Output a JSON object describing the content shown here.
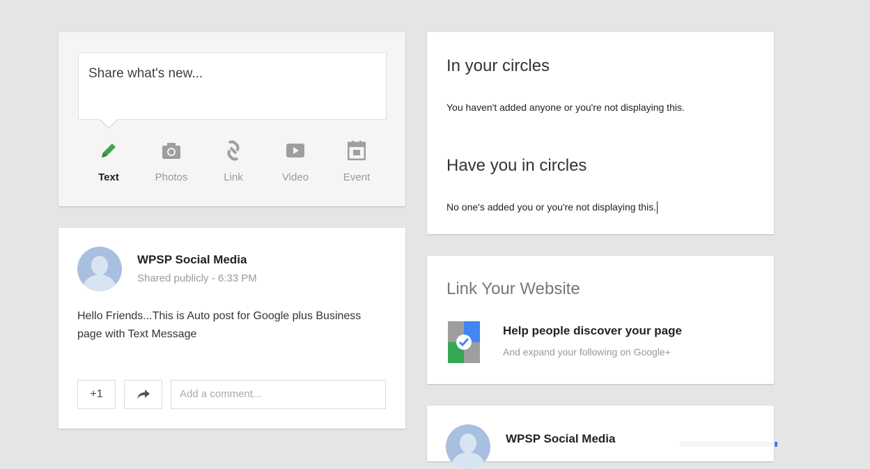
{
  "share": {
    "placeholder": "Share what's new...",
    "options": [
      {
        "label": "Text",
        "icon": "pencil-icon",
        "active": true
      },
      {
        "label": "Photos",
        "icon": "camera-icon",
        "active": false
      },
      {
        "label": "Link",
        "icon": "link-icon",
        "active": false
      },
      {
        "label": "Video",
        "icon": "video-icon",
        "active": false
      },
      {
        "label": "Event",
        "icon": "calendar-icon",
        "active": false
      }
    ]
  },
  "post": {
    "author": "WPSP Social Media",
    "meta": "Shared publicly  -  6:33 PM",
    "text": "Hello Friends...This is Auto post for Google plus Business page with Text Message",
    "plus_one": "+1",
    "share_icon": "share-arrow-icon",
    "comment_placeholder": "Add a comment..."
  },
  "circles": {
    "in_title": "In your circles",
    "in_text": "You haven't added anyone or you're not displaying this.",
    "have_title": "Have you in circles",
    "have_text": "No one's added you or you're not displaying this."
  },
  "link_site": {
    "title": "Link Your Website",
    "headline": "Help people discover your page",
    "subtext": "And expand your following on Google+",
    "logo_icon": "verified-site-icon"
  },
  "bottom_post": {
    "author": "WPSP Social Media"
  },
  "colors": {
    "accent_green": "#34a853",
    "accent_blue": "#4285f4",
    "accent_red": "#ea4335",
    "background": "#e5e5e5"
  }
}
